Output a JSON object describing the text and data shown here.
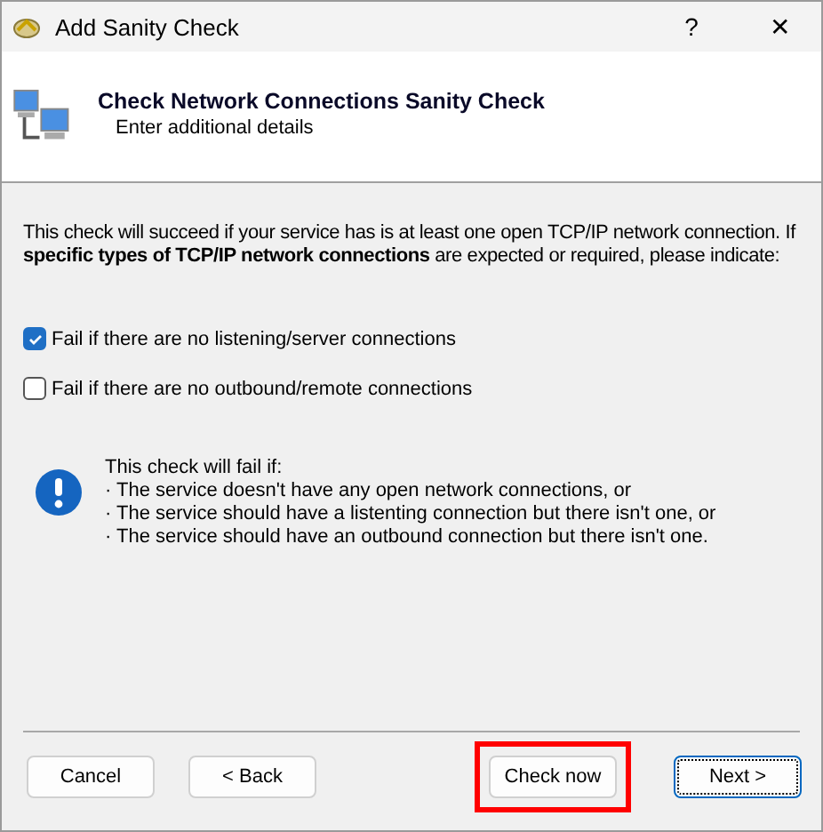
{
  "window": {
    "title": "Add Sanity Check",
    "help": "?",
    "close": "✕"
  },
  "header": {
    "title": "Check Network Connections Sanity Check",
    "subtitle": "Enter additional details"
  },
  "intro": "This check will succeed if your service has is at least one open TCP/IP network connection. If **specific types of TCP/IP network connections** are expected or required, please indicate:",
  "options": [
    {
      "label": "Fail if there are no listening/server connections",
      "checked": true
    },
    {
      "label": "Fail if there are no outbound/remote connections",
      "checked": false
    }
  ],
  "info": {
    "lines": [
      "This check will fail if:",
      "· The service doesn't have any open network connections, or",
      "· The service should have a listenting connection but there isn't one, or",
      "· The service should have an outbound connection but there isn't one."
    ]
  },
  "buttons": [
    {
      "label": "Cancel",
      "highlighted": false,
      "default": false
    },
    {
      "label": "< Back",
      "highlighted": false,
      "default": false
    },
    {
      "label": "Check now",
      "highlighted": true,
      "default": false
    },
    {
      "label": "Next >",
      "highlighted": false,
      "default": true
    }
  ]
}
